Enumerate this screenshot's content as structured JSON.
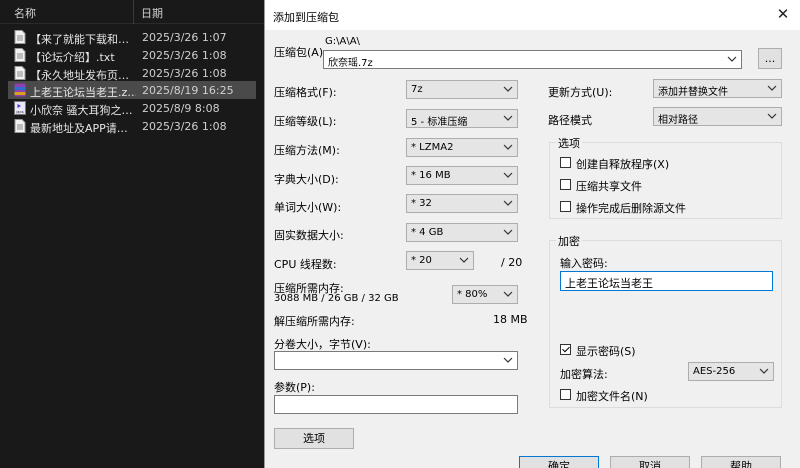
{
  "explorer": {
    "columns": {
      "name": "名称",
      "date": "日期"
    },
    "files": [
      {
        "name": "【来了就能下载和…",
        "date": "2025/3/26 1:07",
        "icon": "text-file-icon"
      },
      {
        "name": "【论坛介绍】.txt",
        "date": "2025/3/26 1:08",
        "icon": "text-file-icon"
      },
      {
        "name": "【永久地址发布页…",
        "date": "2025/3/26 1:08",
        "icon": "text-file-icon"
      },
      {
        "name": "上老王论坛当老王.z…",
        "date": "2025/8/19 16:25",
        "icon": "archive-file-icon"
      },
      {
        "name": "小欣奈 骚大耳狗之…",
        "date": "2025/8/9 8:08",
        "icon": "mp4-file-icon"
      },
      {
        "name": "最新地址及APP请…",
        "date": "2025/3/26 1:08",
        "icon": "text-file-icon"
      }
    ]
  },
  "dialog": {
    "title": "添加到压缩包",
    "archive_label": "压缩包(A):",
    "archive_path": "G:\\A\\A\\",
    "archive_name": "欣奈瑶.7z",
    "browse_label": "...",
    "format_label": "压缩格式(F):",
    "format_value": "7z",
    "level_label": "压缩等级(L):",
    "level_value": "5 - 标准压缩",
    "method_label": "压缩方法(M):",
    "method_value": "* LZMA2",
    "dict_label": "字典大小(D):",
    "dict_value": "* 16 MB",
    "word_label": "单词大小(W):",
    "word_value": "* 32",
    "solid_label": "固实数据大小:",
    "solid_value": "* 4 GB",
    "cpu_label": "CPU 线程数:",
    "cpu_value": "* 20",
    "cpu_total": "/ 20",
    "mem_comp_label": "压缩所需内存:",
    "mem_comp_detail": "3088 MB / 26 GB / 32 GB",
    "mem_comp_value": "* 80%",
    "mem_decomp_label": "解压缩所需内存:",
    "mem_decomp_value": "18 MB",
    "split_label": "分卷大小，字节(V):",
    "split_value": "",
    "params_label": "参数(P):",
    "params_value": "",
    "options_button": "选项",
    "update_label": "更新方式(U):",
    "update_value": "添加并替换文件",
    "path_mode_label": "路径模式",
    "path_mode_value": "相对路径",
    "options_group": {
      "title": "选项",
      "sfx": "创建自释放程序(X)",
      "shared": "压缩共享文件",
      "delete_after": "操作完成后删除源文件"
    },
    "encryption_group": {
      "title": "加密",
      "password_label": "输入密码:",
      "password_value": "上老王论坛当老王",
      "show_password": "显示密码(S)",
      "method_label": "加密算法:",
      "method_value": "AES-256",
      "encrypt_names": "加密文件名(N)"
    },
    "ok_button": "确定",
    "cancel_button": "取消",
    "help_button": "帮助"
  }
}
